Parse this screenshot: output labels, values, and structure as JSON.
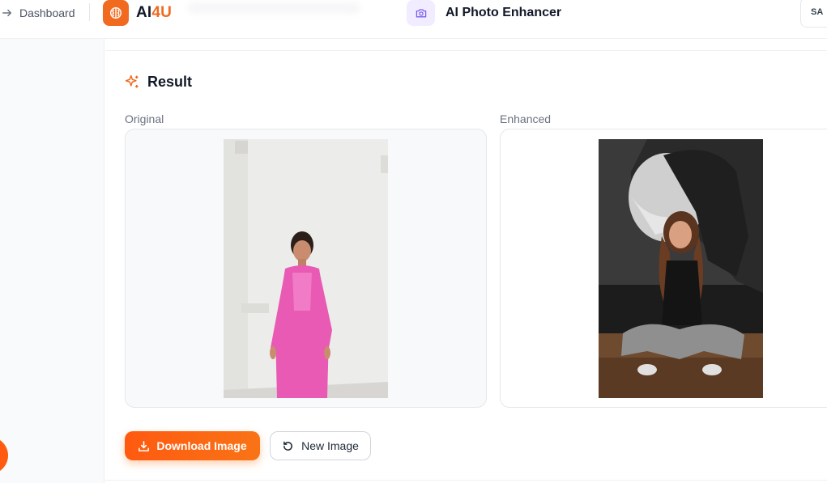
{
  "header": {
    "back_label": "Dashboard",
    "brand": {
      "prefix": "AI",
      "accent": "4U"
    },
    "tool_title": "AI Photo Enhancer",
    "user_initials": "SA"
  },
  "result": {
    "heading": "Result",
    "original_label": "Original",
    "enhanced_label": "Enhanced"
  },
  "actions": {
    "download_label": "Download Image",
    "new_label": "New Image"
  },
  "colors": {
    "brand_orange": "#f06a1f",
    "button_orange": "#ff5a10",
    "tool_icon_bg": "#f1ecff",
    "tool_icon_fg": "#7c5cf0"
  },
  "icons": {
    "back": "arrow-right-icon",
    "logo": "brain-icon",
    "tool": "camera-icon",
    "result": "sparkles-icon",
    "download": "download-icon",
    "new": "refresh-icon"
  }
}
